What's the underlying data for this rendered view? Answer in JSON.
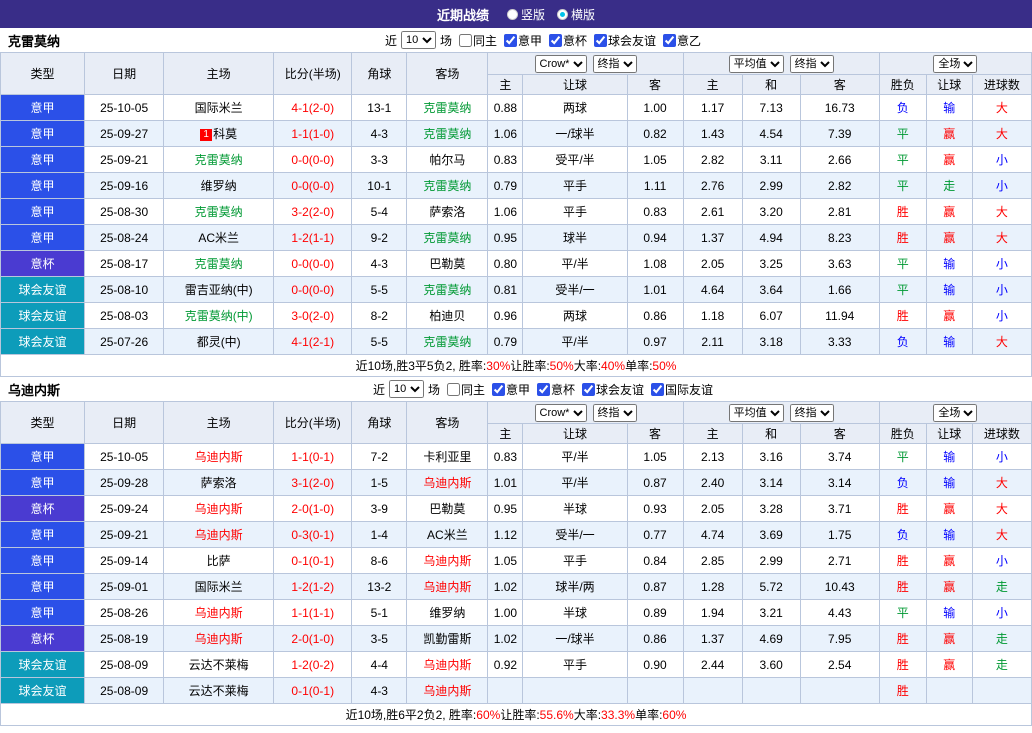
{
  "topbar": {
    "title": "近期战绩",
    "radios": [
      {
        "label": "竖版",
        "selected": false
      },
      {
        "label": "横版",
        "selected": true
      }
    ]
  },
  "table_header": {
    "cols": [
      "类型",
      "日期",
      "主场",
      "比分(半场)",
      "角球",
      "客场"
    ],
    "odds_group": {
      "select1": "Crow*",
      "select2": "终指",
      "sub": [
        "主",
        "让球",
        "客"
      ]
    },
    "avg_group": {
      "select1": "平均值",
      "select2": "终指",
      "sub": [
        "主",
        "和",
        "客"
      ]
    },
    "result_group": {
      "select": "全场",
      "sub": [
        "胜负",
        "让球",
        "进球数"
      ]
    }
  },
  "colors": {
    "league": {
      "意甲": "#2b50e8",
      "意杯": "#4a3bd1",
      "球会友谊": "#0d9cba"
    },
    "result": {
      "r": "#ff0000",
      "b": "#0000ff",
      "g": "#009933"
    },
    "score": "#ff0000"
  },
  "sections": [
    {
      "team": "克雷莫纳",
      "team_color": "#009933",
      "filter": {
        "near": "近",
        "count": "10",
        "games": "场",
        "checkboxes": [
          {
            "label": "同主",
            "checked": false
          },
          {
            "label": "意甲",
            "checked": true
          },
          {
            "label": "意杯",
            "checked": true
          },
          {
            "label": "球会友谊",
            "checked": true
          },
          {
            "label": "意乙",
            "checked": true
          }
        ]
      },
      "rows": [
        {
          "league": "意甲",
          "date": "25-10-05",
          "home": {
            "name": "国际米兰"
          },
          "score": "4-1(2-0)",
          "corner": "13-1",
          "away": {
            "name": "克雷莫纳",
            "hl": true
          },
          "odds": [
            "0.88",
            "两球",
            "1.00"
          ],
          "avg": [
            "1.17",
            "7.13",
            "16.73"
          ],
          "results": [
            [
              "负",
              "b"
            ],
            [
              "输",
              "b"
            ],
            [
              "大",
              "r"
            ]
          ]
        },
        {
          "league": "意甲",
          "date": "25-09-27",
          "home": {
            "name": "科莫",
            "badge": "1"
          },
          "score": "1-1(1-0)",
          "corner": "4-3",
          "away": {
            "name": "克雷莫纳",
            "hl": true
          },
          "odds": [
            "1.06",
            "一/球半",
            "0.82"
          ],
          "avg": [
            "1.43",
            "4.54",
            "7.39"
          ],
          "results": [
            [
              "平",
              "g"
            ],
            [
              "赢",
              "r"
            ],
            [
              "大",
              "r"
            ]
          ]
        },
        {
          "league": "意甲",
          "date": "25-09-21",
          "home": {
            "name": "克雷莫纳",
            "hl": true
          },
          "score": "0-0(0-0)",
          "corner": "3-3",
          "away": {
            "name": "帕尔马"
          },
          "odds": [
            "0.83",
            "受平/半",
            "1.05"
          ],
          "avg": [
            "2.82",
            "3.11",
            "2.66"
          ],
          "results": [
            [
              "平",
              "g"
            ],
            [
              "赢",
              "r"
            ],
            [
              "小",
              "b"
            ]
          ]
        },
        {
          "league": "意甲",
          "date": "25-09-16",
          "home": {
            "name": "维罗纳"
          },
          "score": "0-0(0-0)",
          "corner": "10-1",
          "away": {
            "name": "克雷莫纳",
            "hl": true
          },
          "odds": [
            "0.79",
            "平手",
            "1.11"
          ],
          "avg": [
            "2.76",
            "2.99",
            "2.82"
          ],
          "results": [
            [
              "平",
              "g"
            ],
            [
              "走",
              "g"
            ],
            [
              "小",
              "b"
            ]
          ]
        },
        {
          "league": "意甲",
          "date": "25-08-30",
          "home": {
            "name": "克雷莫纳",
            "hl": true
          },
          "score": "3-2(2-0)",
          "corner": "5-4",
          "away": {
            "name": "萨索洛"
          },
          "odds": [
            "1.06",
            "平手",
            "0.83"
          ],
          "avg": [
            "2.61",
            "3.20",
            "2.81"
          ],
          "results": [
            [
              "胜",
              "r"
            ],
            [
              "赢",
              "r"
            ],
            [
              "大",
              "r"
            ]
          ]
        },
        {
          "league": "意甲",
          "date": "25-08-24",
          "home": {
            "name": "AC米兰"
          },
          "score": "1-2(1-1)",
          "corner": "9-2",
          "away": {
            "name": "克雷莫纳",
            "hl": true
          },
          "odds": [
            "0.95",
            "球半",
            "0.94"
          ],
          "avg": [
            "1.37",
            "4.94",
            "8.23"
          ],
          "results": [
            [
              "胜",
              "r"
            ],
            [
              "赢",
              "r"
            ],
            [
              "大",
              "r"
            ]
          ]
        },
        {
          "league": "意杯",
          "date": "25-08-17",
          "home": {
            "name": "克雷莫纳",
            "hl": true
          },
          "score": "0-0(0-0)",
          "corner": "4-3",
          "away": {
            "name": "巴勒莫"
          },
          "odds": [
            "0.80",
            "平/半",
            "1.08"
          ],
          "avg": [
            "2.05",
            "3.25",
            "3.63"
          ],
          "results": [
            [
              "平",
              "g"
            ],
            [
              "输",
              "b"
            ],
            [
              "小",
              "b"
            ]
          ]
        },
        {
          "league": "球会友谊",
          "date": "25-08-10",
          "home": {
            "name": "雷吉亚纳(中)"
          },
          "score": "0-0(0-0)",
          "corner": "5-5",
          "away": {
            "name": "克雷莫纳",
            "hl": true
          },
          "odds": [
            "0.81",
            "受半/一",
            "1.01"
          ],
          "avg": [
            "4.64",
            "3.64",
            "1.66"
          ],
          "results": [
            [
              "平",
              "g"
            ],
            [
              "输",
              "b"
            ],
            [
              "小",
              "b"
            ]
          ]
        },
        {
          "league": "球会友谊",
          "date": "25-08-03",
          "home": {
            "name": "克雷莫纳(中)",
            "hl": true
          },
          "score": "3-0(2-0)",
          "corner": "8-2",
          "away": {
            "name": "柏迪贝"
          },
          "odds": [
            "0.96",
            "两球",
            "0.86"
          ],
          "avg": [
            "1.18",
            "6.07",
            "11.94"
          ],
          "results": [
            [
              "胜",
              "r"
            ],
            [
              "赢",
              "r"
            ],
            [
              "小",
              "b"
            ]
          ]
        },
        {
          "league": "球会友谊",
          "date": "25-07-26",
          "home": {
            "name": "都灵(中)"
          },
          "score": "4-1(2-1)",
          "corner": "5-5",
          "away": {
            "name": "克雷莫纳",
            "hl": true
          },
          "odds": [
            "0.79",
            "平/半",
            "0.97"
          ],
          "avg": [
            "2.11",
            "3.18",
            "3.33"
          ],
          "results": [
            [
              "负",
              "b"
            ],
            [
              "输",
              "b"
            ],
            [
              "大",
              "r"
            ]
          ]
        }
      ],
      "summary": [
        [
          "近10场,胜3平5负2, 胜率:",
          "k"
        ],
        [
          "30%",
          "r"
        ],
        [
          " 让胜率:",
          "k"
        ],
        [
          "50%",
          "r"
        ],
        [
          " 大率:",
          "k"
        ],
        [
          "40%",
          "r"
        ],
        [
          " 单率:",
          "k"
        ],
        [
          "50%",
          "r"
        ]
      ]
    },
    {
      "team": "乌迪内斯",
      "team_color": "#ff0000",
      "filter": {
        "near": "近",
        "count": "10",
        "games": "场",
        "checkboxes": [
          {
            "label": "同主",
            "checked": false
          },
          {
            "label": "意甲",
            "checked": true
          },
          {
            "label": "意杯",
            "checked": true
          },
          {
            "label": "球会友谊",
            "checked": true
          },
          {
            "label": "国际友谊",
            "checked": true
          }
        ]
      },
      "rows": [
        {
          "league": "意甲",
          "date": "25-10-05",
          "home": {
            "name": "乌迪内斯",
            "hl": true
          },
          "score": "1-1(0-1)",
          "corner": "7-2",
          "away": {
            "name": "卡利亚里"
          },
          "odds": [
            "0.83",
            "平/半",
            "1.05"
          ],
          "avg": [
            "2.13",
            "3.16",
            "3.74"
          ],
          "results": [
            [
              "平",
              "g"
            ],
            [
              "输",
              "b"
            ],
            [
              "小",
              "b"
            ]
          ]
        },
        {
          "league": "意甲",
          "date": "25-09-28",
          "home": {
            "name": "萨索洛"
          },
          "score": "3-1(2-0)",
          "corner": "1-5",
          "away": {
            "name": "乌迪内斯",
            "hl": true
          },
          "odds": [
            "1.01",
            "平/半",
            "0.87"
          ],
          "avg": [
            "2.40",
            "3.14",
            "3.14"
          ],
          "results": [
            [
              "负",
              "b"
            ],
            [
              "输",
              "b"
            ],
            [
              "大",
              "r"
            ]
          ]
        },
        {
          "league": "意杯",
          "date": "25-09-24",
          "home": {
            "name": "乌迪内斯",
            "hl": true
          },
          "score": "2-0(1-0)",
          "corner": "3-9",
          "away": {
            "name": "巴勒莫"
          },
          "odds": [
            "0.95",
            "半球",
            "0.93"
          ],
          "avg": [
            "2.05",
            "3.28",
            "3.71"
          ],
          "results": [
            [
              "胜",
              "r"
            ],
            [
              "赢",
              "r"
            ],
            [
              "大",
              "r"
            ]
          ]
        },
        {
          "league": "意甲",
          "date": "25-09-21",
          "home": {
            "name": "乌迪内斯",
            "hl": true
          },
          "score": "0-3(0-1)",
          "corner": "1-4",
          "away": {
            "name": "AC米兰"
          },
          "odds": [
            "1.12",
            "受半/一",
            "0.77"
          ],
          "avg": [
            "4.74",
            "3.69",
            "1.75"
          ],
          "results": [
            [
              "负",
              "b"
            ],
            [
              "输",
              "b"
            ],
            [
              "大",
              "r"
            ]
          ]
        },
        {
          "league": "意甲",
          "date": "25-09-14",
          "home": {
            "name": "比萨"
          },
          "score": "0-1(0-1)",
          "corner": "8-6",
          "away": {
            "name": "乌迪内斯",
            "hl": true
          },
          "odds": [
            "1.05",
            "平手",
            "0.84"
          ],
          "avg": [
            "2.85",
            "2.99",
            "2.71"
          ],
          "results": [
            [
              "胜",
              "r"
            ],
            [
              "赢",
              "r"
            ],
            [
              "小",
              "b"
            ]
          ]
        },
        {
          "league": "意甲",
          "date": "25-09-01",
          "home": {
            "name": "国际米兰"
          },
          "score": "1-2(1-2)",
          "corner": "13-2",
          "away": {
            "name": "乌迪内斯",
            "hl": true
          },
          "odds": [
            "1.02",
            "球半/两",
            "0.87"
          ],
          "avg": [
            "1.28",
            "5.72",
            "10.43"
          ],
          "results": [
            [
              "胜",
              "r"
            ],
            [
              "赢",
              "r"
            ],
            [
              "走",
              "g"
            ]
          ]
        },
        {
          "league": "意甲",
          "date": "25-08-26",
          "home": {
            "name": "乌迪内斯",
            "hl": true
          },
          "score": "1-1(1-1)",
          "corner": "5-1",
          "away": {
            "name": "维罗纳"
          },
          "odds": [
            "1.00",
            "半球",
            "0.89"
          ],
          "avg": [
            "1.94",
            "3.21",
            "4.43"
          ],
          "results": [
            [
              "平",
              "g"
            ],
            [
              "输",
              "b"
            ],
            [
              "小",
              "b"
            ]
          ]
        },
        {
          "league": "意杯",
          "date": "25-08-19",
          "home": {
            "name": "乌迪内斯",
            "hl": true
          },
          "score": "2-0(1-0)",
          "corner": "3-5",
          "away": {
            "name": "凯勤雷斯"
          },
          "odds": [
            "1.02",
            "一/球半",
            "0.86"
          ],
          "avg": [
            "1.37",
            "4.69",
            "7.95"
          ],
          "results": [
            [
              "胜",
              "r"
            ],
            [
              "赢",
              "r"
            ],
            [
              "走",
              "g"
            ]
          ]
        },
        {
          "league": "球会友谊",
          "date": "25-08-09",
          "home": {
            "name": "云达不莱梅"
          },
          "score": "1-2(0-2)",
          "corner": "4-4",
          "away": {
            "name": "乌迪内斯",
            "hl": true
          },
          "odds": [
            "0.92",
            "平手",
            "0.90"
          ],
          "avg": [
            "2.44",
            "3.60",
            "2.54"
          ],
          "results": [
            [
              "胜",
              "r"
            ],
            [
              "赢",
              "r"
            ],
            [
              "走",
              "g"
            ]
          ]
        },
        {
          "league": "球会友谊",
          "date": "25-08-09",
          "home": {
            "name": "云达不莱梅"
          },
          "score": "0-1(0-1)",
          "corner": "4-3",
          "away": {
            "name": "乌迪内斯",
            "hl": true
          },
          "odds": [
            "",
            "",
            ""
          ],
          "avg": [
            "",
            "",
            ""
          ],
          "results": [
            [
              "胜",
              "r"
            ],
            [
              "",
              ""
            ],
            [
              "",
              ""
            ]
          ]
        }
      ],
      "summary": [
        [
          "近10场,胜6平2负2, 胜率:",
          "k"
        ],
        [
          "60%",
          "r"
        ],
        [
          " 让胜率:",
          "k"
        ],
        [
          "55.6%",
          "r"
        ],
        [
          " 大率:",
          "k"
        ],
        [
          "33.3%",
          "r"
        ],
        [
          " 单率:",
          "k"
        ],
        [
          "60%",
          "r"
        ]
      ]
    }
  ]
}
